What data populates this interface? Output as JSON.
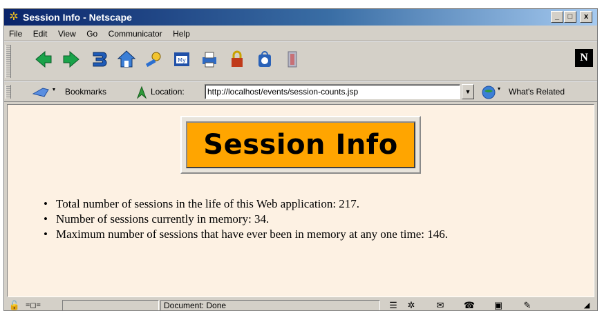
{
  "window": {
    "title": "Session Info - Netscape",
    "buttons": {
      "minimize": "_",
      "maximize": "□",
      "close": "x"
    }
  },
  "menu": [
    "File",
    "Edit",
    "View",
    "Go",
    "Communicator",
    "Help"
  ],
  "nav_toolbar": {
    "icons": [
      "back-icon",
      "forward-icon",
      "reload-icon",
      "home-icon",
      "search-icon",
      "my-netscape-icon",
      "print-icon",
      "security-icon",
      "shop-icon",
      "stop-icon"
    ],
    "logo": "N"
  },
  "location_toolbar": {
    "bookmarks_label": "Bookmarks",
    "location_label": "Location:",
    "url": "http://localhost/events/session-counts.jsp",
    "whats_related_label": "What's Related"
  },
  "page": {
    "banner": "Session Info",
    "items": [
      "Total number of sessions in the life of this Web application: 217.",
      "Number of sessions currently in memory: 34.",
      "Maximum number of sessions that have ever been in memory at any one time: 146."
    ],
    "background_color": "#fdf1e3",
    "banner_color": "#ffa500"
  },
  "status": {
    "text": "Document: Done"
  }
}
